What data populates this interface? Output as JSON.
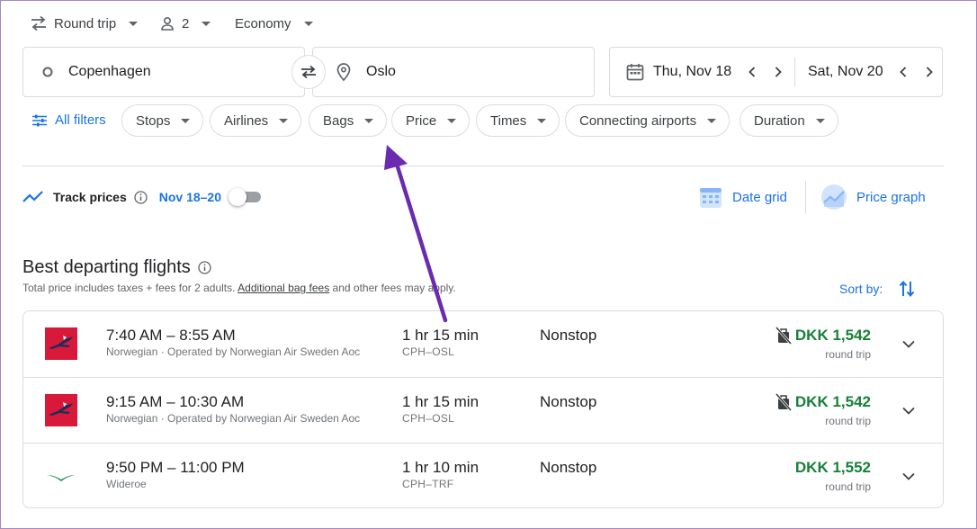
{
  "trip_options": {
    "trip_type": "Round trip",
    "passengers": "2",
    "cabin": "Economy"
  },
  "search": {
    "origin": "Copenhagen",
    "destination": "Oslo",
    "depart_date": "Thu, Nov 18",
    "return_date": "Sat, Nov 20"
  },
  "filters": {
    "all_filters": "All filters",
    "chips": [
      "Stops",
      "Airlines",
      "Bags",
      "Price",
      "Times",
      "Connecting airports",
      "Duration"
    ]
  },
  "track": {
    "label": "Track prices",
    "dates": "Nov 18–20",
    "date_grid": "Date grid",
    "price_graph": "Price graph"
  },
  "section": {
    "title": "Best departing flights",
    "subtitle_pre": "Total price includes taxes + fees for 2 adults. ",
    "subtitle_link": "Additional bag fees",
    "subtitle_post": " and other fees may apply.",
    "sort_label": "Sort by:"
  },
  "flights": [
    {
      "times": "7:40 AM – 8:55 AM",
      "airline": "Norwegian · Operated by Norwegian Air Sweden Aoc",
      "duration": "1 hr 15 min",
      "route": "CPH–OSL",
      "stops": "Nonstop",
      "price": "DKK 1,542",
      "price_type": "round trip",
      "logo": "norwegian-logo",
      "no_carry_on": true
    },
    {
      "times": "9:15 AM – 10:30 AM",
      "airline": "Norwegian · Operated by Norwegian Air Sweden Aoc",
      "duration": "1 hr 15 min",
      "route": "CPH–OSL",
      "stops": "Nonstop",
      "price": "DKK 1,542",
      "price_type": "round trip",
      "logo": "norwegian-logo",
      "no_carry_on": true
    },
    {
      "times": "9:50 PM – 11:00 PM",
      "airline": "Wideroe",
      "duration": "1 hr 10 min",
      "route": "CPH–TRF",
      "stops": "Nonstop",
      "price": "DKK 1,552",
      "price_type": "round trip",
      "logo": "wideroe-logo",
      "no_carry_on": false
    }
  ],
  "colors": {
    "accent_blue": "#1a73e8",
    "price_green": "#188038",
    "annotation_arrow": "#6a2bb0",
    "norwegian_red": "#d81939"
  }
}
